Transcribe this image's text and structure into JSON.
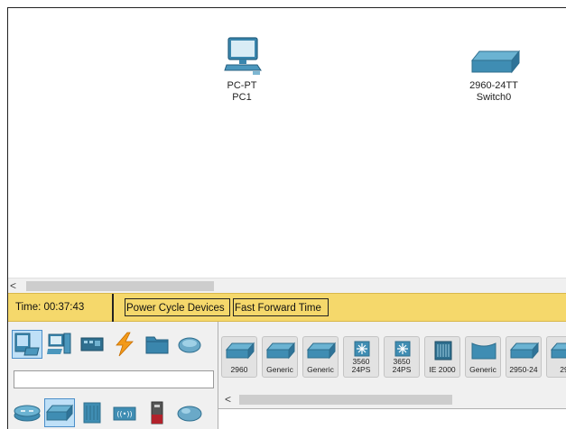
{
  "workspace": {
    "devices": [
      {
        "model": "PC-PT",
        "name": "PC1",
        "icon": "pc-icon"
      },
      {
        "model": "2960-24TT",
        "name": "Switch0",
        "icon": "switch-icon"
      }
    ]
  },
  "scrollbar": {
    "left_arrow": "<"
  },
  "timebar": {
    "time": "Time: 00:37:43",
    "power_cycle": "Power Cycle Devices",
    "fast_forward": "Fast Forward Time"
  },
  "categories": {
    "top": [
      "network-devices",
      "end-devices",
      "components",
      "connections",
      "miscellaneous",
      "multiuser"
    ],
    "sub": [
      "routers",
      "switches",
      "hubs",
      "wireless-devices",
      "security",
      "wan-emulation"
    ],
    "selected_top": "network-devices",
    "selected_sub": "switches"
  },
  "models": [
    {
      "label": "2960",
      "icon": "switch-icon"
    },
    {
      "label": "Generic",
      "icon": "switch-icon"
    },
    {
      "label": "Generic",
      "icon": "switch-icon"
    },
    {
      "label": "3560\n24PS",
      "icon": "multilayer-switch-icon"
    },
    {
      "label": "3650\n24PS",
      "icon": "multilayer-switch-icon"
    },
    {
      "label": "IE 2000",
      "icon": "industrial-switch-icon"
    },
    {
      "label": "Generic",
      "icon": "bridge-icon"
    },
    {
      "label": "2950-24",
      "icon": "switch-icon"
    },
    {
      "label": "29",
      "icon": "switch-icon"
    }
  ],
  "colors": {
    "timebar": "#f5d86b",
    "selected": "#bfe0f7",
    "device_blue": "#3d8fb3"
  }
}
